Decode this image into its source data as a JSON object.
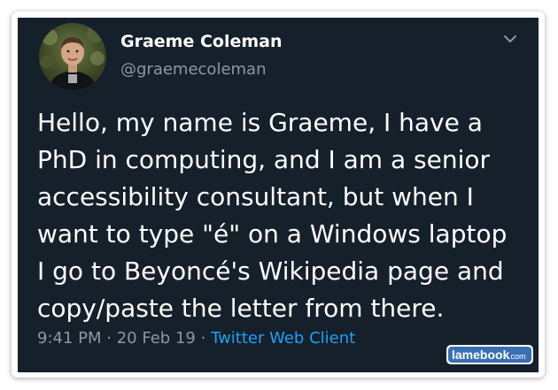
{
  "tweet": {
    "author_name": "Graeme Coleman",
    "author_handle": "@graemecoleman",
    "body": "Hello, my name is Graeme, I have a\nPhD in computing, and I am a senior\naccessibility consultant, but when I\nwant to type \"é\" on a Windows laptop\nI go to Beyoncé's Wikipedia page and\ncopy/paste the letter from there.",
    "time": "9:41 PM",
    "separator": "·",
    "date": "20 Feb 19",
    "client": "Twitter Web Client"
  },
  "watermark": {
    "brand": "lamebook",
    "tld": ".com"
  },
  "colors": {
    "card_background": "#15202b",
    "text_primary": "#ffffff",
    "text_secondary": "#8899a6",
    "link": "#1da1f2"
  },
  "icons": {
    "menu": "chevron-down-icon",
    "avatar": "profile-photo"
  }
}
